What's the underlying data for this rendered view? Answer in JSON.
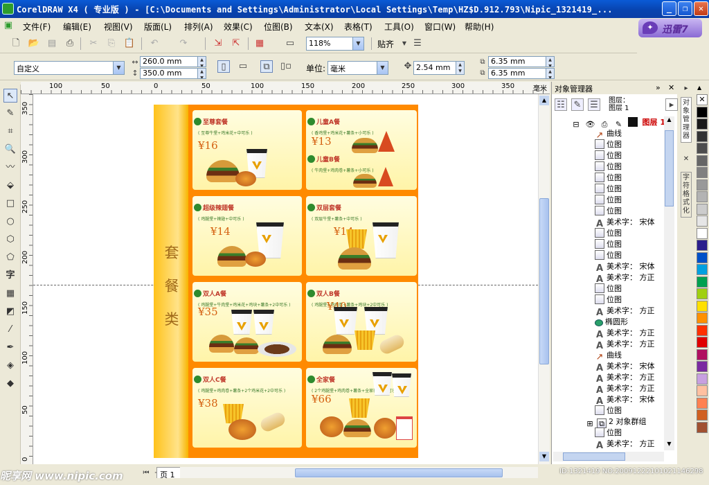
{
  "window": {
    "title": "CorelDRAW X4 ( 专业版 ) - [C:\\Documents and Settings\\Administrator\\Local Settings\\Temp\\HZ$D.912.793\\Nipic_1321419_..."
  },
  "menu": [
    "文件(F)",
    "编辑(E)",
    "视图(V)",
    "版面(L)",
    "排列(A)",
    "效果(C)",
    "位图(B)",
    "文本(X)",
    "表格(T)",
    "工具(O)",
    "窗口(W)",
    "帮助(H)"
  ],
  "xunlei": {
    "label": "迅雷7"
  },
  "toolbar": {
    "zoom": "118%",
    "snap_label": "贴齐"
  },
  "property_bar": {
    "paper": "自定义",
    "width": "260.0 mm",
    "height": "350.0 mm",
    "unit_label": "单位:",
    "unit": "毫米",
    "nudge": "2.54 mm",
    "dup_x": "6.35 mm",
    "dup_y": "6.35 mm"
  },
  "ruler": {
    "h_labels": [
      "100",
      "50",
      "0",
      "50",
      "100",
      "150",
      "200",
      "250",
      "300",
      "350",
      "毫米"
    ],
    "v_labels": [
      "350",
      "300",
      "250",
      "200",
      "150",
      "100",
      "50",
      "0"
    ]
  },
  "menu_board": {
    "category": [
      "套",
      "餐",
      "类"
    ],
    "items": [
      {
        "name": "至尊套餐",
        "desc": "( 至尊牛堡+鸡米花+中可乐 )",
        "price": "¥16"
      },
      {
        "name": "儿童A餐",
        "desc": "( 香鸡堡+鸡米花+薯条+小可乐 )",
        "price": "¥13"
      },
      {
        "name": "儿童B餐",
        "desc": "( 牛肉堡+鸡肉卷+薯条+小可乐 )",
        "price": ""
      },
      {
        "name": "超级辣翅餐",
        "desc": "( 鸡腿堡+辣翅+中可乐 )",
        "price": "¥14"
      },
      {
        "name": "双层套餐",
        "desc": "( 双层牛堡+薯条+中可乐 )",
        "price": "¥14"
      },
      {
        "name": "双人A餐",
        "desc": "( 鸡腿堡+牛肉堡+鸡米花+鸡块+薯条+2中可乐 )",
        "price": "¥35"
      },
      {
        "name": "双人B餐",
        "desc": "( 鸡腿堡+鸡肉卷+薯条+鸡块+2中可乐 )",
        "price": "¥40"
      },
      {
        "name": "双人C餐",
        "desc": "( 鸡腿堡+鸡肉卷+薯条+2个鸡米花+2中可乐 )",
        "price": "¥38"
      },
      {
        "name": "全家餐",
        "desc": "( 2个鸡腿堡+鸡肉卷+薯条+全家桶+3中可乐 )",
        "price": "¥66"
      }
    ]
  },
  "page_tab": {
    "label": "页 1"
  },
  "object_manager": {
    "title": "对象管理器",
    "layer_label": "图层：",
    "layer_sub": "图层 1",
    "layer_name": "图层 1",
    "rows": [
      {
        "type": "curve",
        "label": "曲线"
      },
      {
        "type": "bitmap",
        "label": "位图"
      },
      {
        "type": "bitmap",
        "label": "位图"
      },
      {
        "type": "bitmap",
        "label": "位图"
      },
      {
        "type": "bitmap",
        "label": "位图"
      },
      {
        "type": "bitmap",
        "label": "位图"
      },
      {
        "type": "bitmap",
        "label": "位图"
      },
      {
        "type": "bitmap",
        "label": "位图"
      },
      {
        "type": "text",
        "label": "美术字： 宋体"
      },
      {
        "type": "bitmap",
        "label": "位图"
      },
      {
        "type": "bitmap",
        "label": "位图"
      },
      {
        "type": "bitmap",
        "label": "位图"
      },
      {
        "type": "text",
        "label": "美术字： 宋体"
      },
      {
        "type": "text",
        "label": "美术字： 方正"
      },
      {
        "type": "bitmap",
        "label": "位图"
      },
      {
        "type": "bitmap",
        "label": "位图"
      },
      {
        "type": "text",
        "label": "美术字： 方正"
      },
      {
        "type": "ellipse",
        "label": "椭圆形"
      },
      {
        "type": "text",
        "label": "美术字： 方正"
      },
      {
        "type": "text",
        "label": "美术字： 方正"
      },
      {
        "type": "curve",
        "label": "曲线"
      },
      {
        "type": "text",
        "label": "美术字： 宋体"
      },
      {
        "type": "text",
        "label": "美术字： 方正"
      },
      {
        "type": "text",
        "label": "美术字： 方正"
      },
      {
        "type": "text",
        "label": "美术字： 宋体"
      },
      {
        "type": "bitmap",
        "label": "位图"
      },
      {
        "type": "group",
        "label": "2 对象群组"
      },
      {
        "type": "bitmap",
        "label": "位图"
      },
      {
        "type": "text",
        "label": "美术字： 方正"
      }
    ]
  },
  "docker_tabs": [
    "对象管理器",
    "字符格式化"
  ],
  "watermark": {
    "left": "昵享网 www.nipic.com",
    "right": "ID:1321419 NO:20091222101021146298"
  },
  "palette": [
    "#ffffff",
    "#000000",
    "#1a1a1a",
    "#333333",
    "#4d4d4d",
    "#666666",
    "#808080",
    "#999999",
    "#b3b3b3",
    "#cccccc",
    "#e6e6e6",
    "#ffffff",
    "#2b1e8c",
    "#0050c8",
    "#00a0e0",
    "#00a050",
    "#a0d010",
    "#ffe000",
    "#ff9000",
    "#ff3000",
    "#e00000",
    "#b01060",
    "#7a2aa0",
    "#c8a0e0",
    "#ffc0a0",
    "#ff8050",
    "#d06020",
    "#a05030"
  ]
}
